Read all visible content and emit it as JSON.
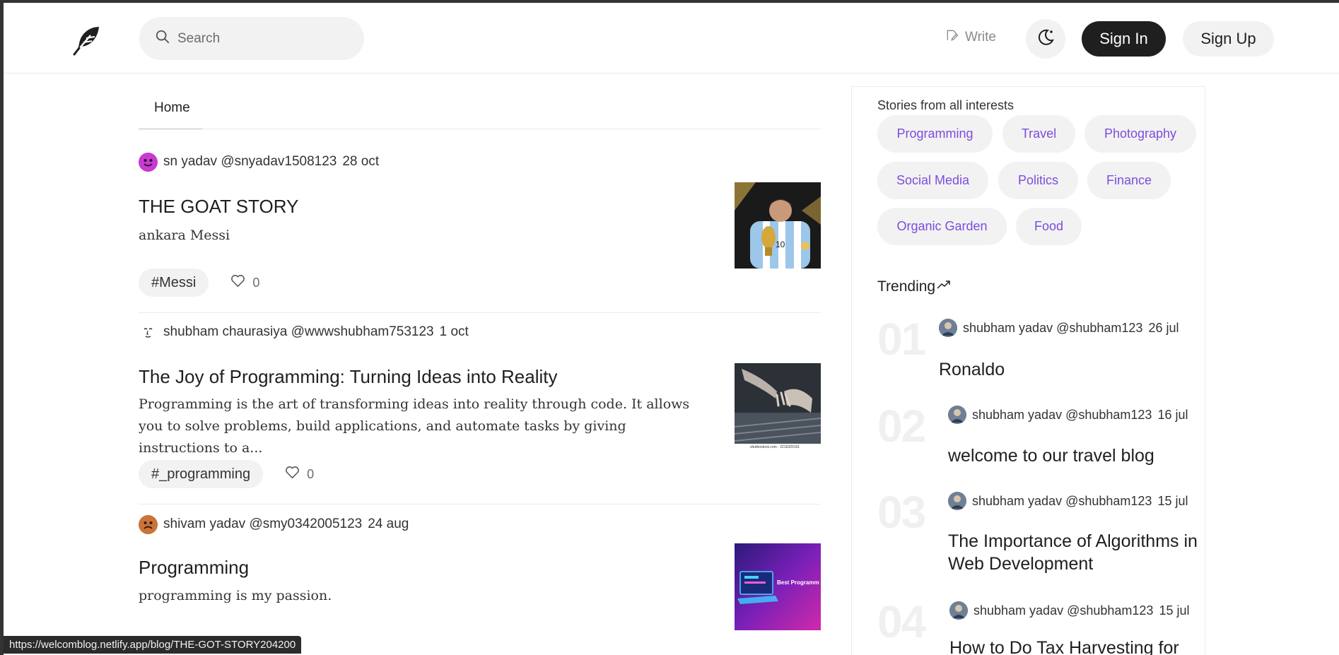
{
  "nav": {
    "search_placeholder": "Search",
    "write_label": "Write",
    "signin_label": "Sign In",
    "signup_label": "Sign Up"
  },
  "tabs": {
    "home": "Home"
  },
  "posts": [
    {
      "author": "sn yadav @snyadav1508123",
      "date": "28 oct",
      "title": "THE GOAT STORY",
      "desc": "ankara Messi",
      "tag": "#Messi",
      "likes": "0"
    },
    {
      "author": "shubham chaurasiya @wwwshubham753123",
      "date": "1 oct",
      "title": "The Joy of Programming: Turning Ideas into Reality",
      "desc": "Programming is the art of transforming ideas into reality through code. It allows you to solve problems, build applications, and automate tasks by giving instructions to a...",
      "tag": "#_programming",
      "likes": "0"
    },
    {
      "author": "shivam yadav @smy0342005123",
      "date": "24 aug",
      "title": "Programming",
      "desc": "programming is my passion.",
      "thumb_text": "Best Programm to Master Your C"
    }
  ],
  "sidebar": {
    "heading": "Stories from all interests",
    "topics": [
      "Programming",
      "Travel",
      "Photography",
      "Social Media",
      "Politics",
      "Finance",
      "Organic Garden",
      "Food"
    ],
    "trending_label": "Trending",
    "trending": [
      {
        "num": "01",
        "author": "shubham yadav @shubham123",
        "date": "26 jul",
        "title": "Ronaldo"
      },
      {
        "num": "02",
        "author": "shubham yadav @shubham123",
        "date": "16 jul",
        "title": "welcome to our travel blog"
      },
      {
        "num": "03",
        "author": "shubham yadav @shubham123",
        "date": "15 jul",
        "title": "The Importance of Algorithms in Web Development"
      },
      {
        "num": "04",
        "author": "shubham yadav @shubham123",
        "date": "15 jul",
        "title": "How to Do Tax Harvesting for"
      }
    ]
  },
  "status_url": "https://welcomblog.netlify.app/blog/THE-GOT-STORY204200",
  "colors": {
    "accent": "#7c4dde",
    "dark_button": "#1f1f1f",
    "chip_bg": "#f2f2f2"
  }
}
